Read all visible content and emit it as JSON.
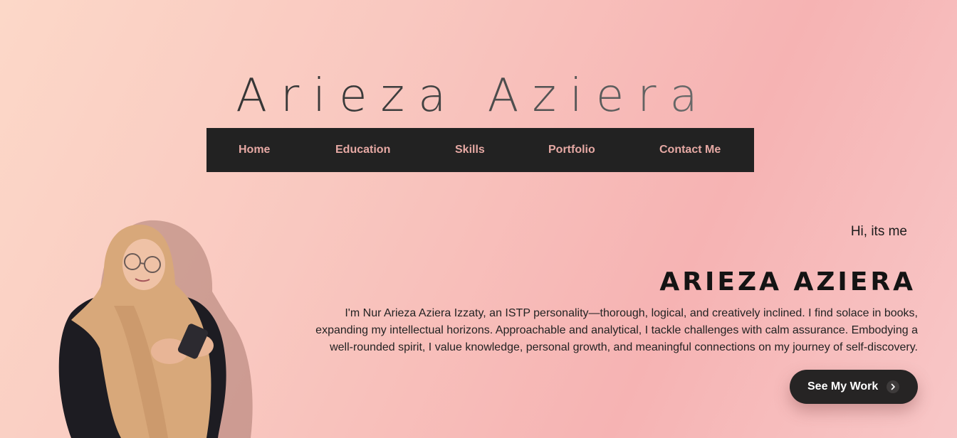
{
  "header": {
    "site_title": "Arieza Aziera"
  },
  "nav": {
    "items": [
      {
        "label": "Home"
      },
      {
        "label": "Education"
      },
      {
        "label": "Skills"
      },
      {
        "label": "Portfolio"
      },
      {
        "label": "Contact Me"
      }
    ]
  },
  "hero": {
    "greeting": "Hi, its me",
    "name": "ARIEZA AZIERA",
    "bio": "I'm Nur Arieza Aziera Izzaty, an ISTP personality—thorough, logical, and creatively inclined. I find solace in books, expanding my intellectual horizons. Approachable and analytical, I tackle challenges with calm assurance. Embodying a well-rounded spirit, I value knowledge, personal growth, and meaningful connections on my journey of self-discovery.",
    "cta_label": "See My Work",
    "cta_icon": "chevron-right-icon"
  },
  "colors": {
    "nav_background": "#222222",
    "nav_text": "#e6a9a4",
    "button_background": "#262424",
    "button_text": "#ffffff"
  }
}
